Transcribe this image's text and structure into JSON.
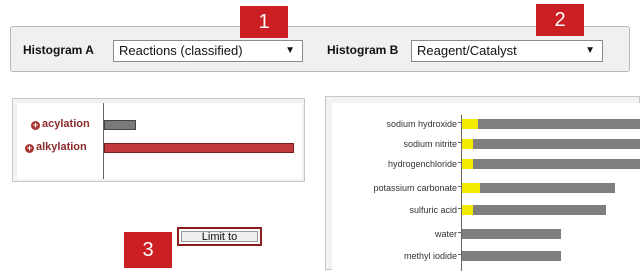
{
  "toolbar": {
    "histogram_a_label": "Histogram A",
    "histogram_a_value": "Reactions (classified)",
    "histogram_b_label": "Histogram B",
    "histogram_b_value": "Reagent/Catalyst"
  },
  "callouts": [
    "1",
    "2",
    "3"
  ],
  "left_chart": {
    "categories": [
      {
        "label": "acylation",
        "value": 0.17,
        "color": "#7a7a7a"
      },
      {
        "label": "alkylation",
        "value": 1.0,
        "color": "#c0393b"
      }
    ]
  },
  "right_chart": {
    "rows": [
      {
        "label": "sodium hydroxide",
        "highlight": 0.09,
        "total": 1.0
      },
      {
        "label": "sodium nitrite",
        "highlight": 0.06,
        "total": 1.0
      },
      {
        "label": "hydrogenchloride",
        "highlight": 0.06,
        "total": 1.0
      },
      {
        "label": "potassium carbonate",
        "highlight": 0.1,
        "total": 0.85
      },
      {
        "label": "sulfuric acid",
        "highlight": 0.06,
        "total": 0.8
      },
      {
        "label": "water",
        "highlight": 0,
        "total": 0.55
      },
      {
        "label": "methyl iodide",
        "highlight": 0,
        "total": 0.55
      }
    ],
    "highlight_color": "#f2ea00",
    "bar_color": "#7f7f7f"
  },
  "limit_button_label": "Limit to"
}
